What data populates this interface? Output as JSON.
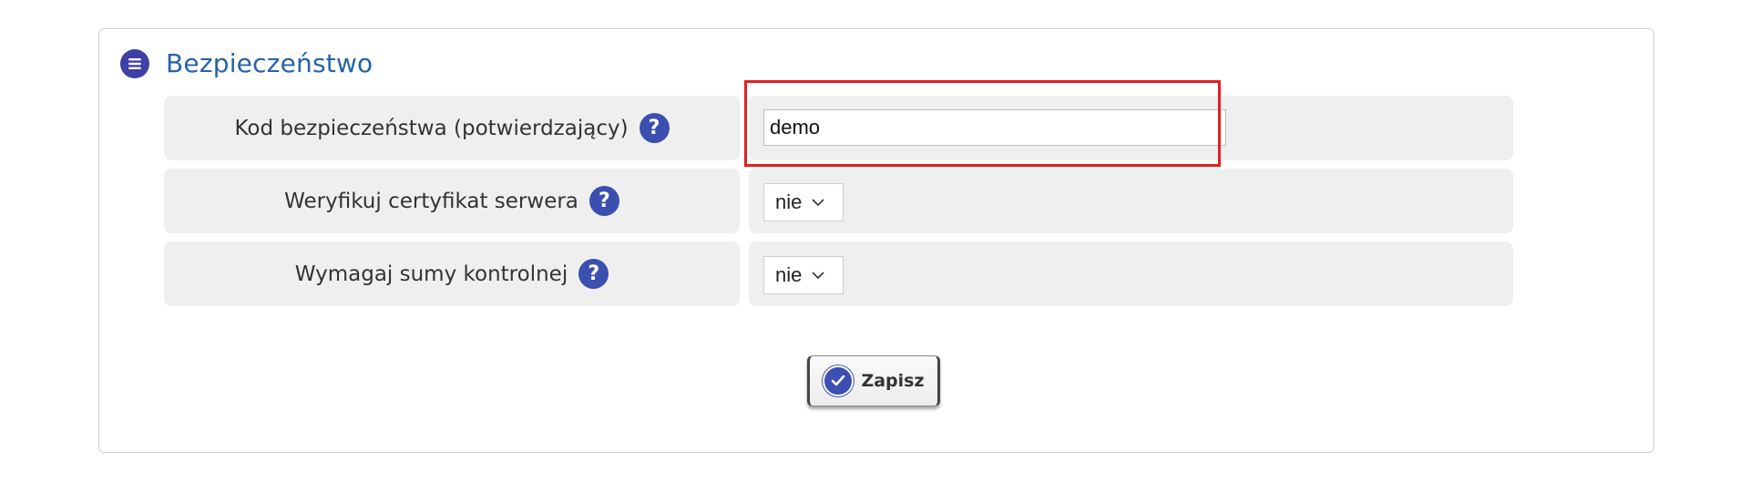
{
  "section": {
    "title": "Bezpieczeństwo",
    "icon": "menu-icon"
  },
  "rows": [
    {
      "label": "Kod bezpieczeństwa (potwierdzający)",
      "help_icon": "question-icon",
      "value": "demo",
      "type": "text"
    },
    {
      "label": "Weryfikuj certyfikat serwera",
      "help_icon": "question-icon",
      "value": "nie",
      "type": "select"
    },
    {
      "label": "Wymagaj sumy kontrolnej",
      "help_icon": "question-icon",
      "value": "nie",
      "type": "select"
    }
  ],
  "help_glyph": "?",
  "save_button": {
    "label": "Zapisz",
    "icon": "check-icon"
  },
  "colors": {
    "title": "#2763a6",
    "icon_blue": "#3f3fa8",
    "row_bg": "#efefef",
    "highlight": "#e02020"
  }
}
